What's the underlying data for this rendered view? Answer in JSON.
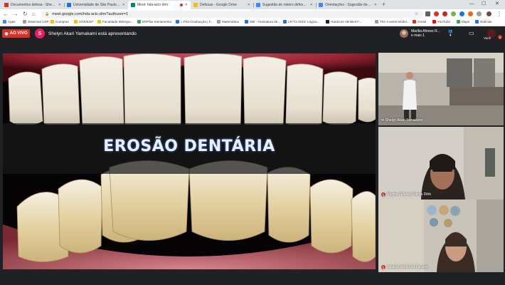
{
  "browser": {
    "tabs": [
      {
        "label": "Documentos defesa - Shelyn Ak",
        "color": "#d93025",
        "active": false
      },
      {
        "label": "Universidade de São Paulo agen",
        "color": "#1a73e8",
        "active": false
      },
      {
        "label": "Meet: hda-actc-dmr",
        "color": "#00897b",
        "active": true
      },
      {
        "label": "Defesas - Google Drive",
        "color": "#fbbc04",
        "active": false
      },
      {
        "label": "Sugestão de roteiro defesa.doc",
        "color": "#4285f4",
        "active": false
      },
      {
        "label": "Orientações - Sugestão de roteir",
        "color": "#4285f4",
        "active": false
      }
    ],
    "new_tab": "+",
    "url": "meet.google.com/hda-actc-dmr?authuser=1",
    "bookmarks": [
      {
        "label": "Apps",
        "color": "#4285f4"
      },
      {
        "label": "Sistemas USP",
        "color": "#9e9e9e"
      },
      {
        "label": "Compras",
        "color": "#fbbc04"
      },
      {
        "label": "UNIVESP",
        "color": "#fbbc04"
      },
      {
        "label": "Faculdade Metropo...",
        "color": "#fbbc04"
      },
      {
        "label": "ERPfax treinamento",
        "color": "#34a853"
      },
      {
        "label": "» Pós-Graduação | F...",
        "color": "#1a73e8"
      },
      {
        "label": "Matemática",
        "color": "#9e9e9e"
      },
      {
        "label": "SBI - Assinatura de...",
        "color": "#1a73e8"
      },
      {
        "label": "LR-T2-2018: Lógica...",
        "color": "#1a73e8"
      },
      {
        "label": "Hardcore 4B Bleit F...",
        "color": "#202124"
      },
      {
        "label": "The 4-week Model...",
        "color": "#9e9e9e"
      },
      {
        "label": "Gmail",
        "color": "#d93025"
      },
      {
        "label": "YouTube",
        "color": "#ff0000"
      },
      {
        "label": "Maps",
        "color": "#34a853"
      },
      {
        "label": "Notícias",
        "color": "#1a73e8"
      }
    ]
  },
  "meet": {
    "live_label": "AO VIVO",
    "presenter_initial": "S",
    "presenting_text": "Shelyn Akari Yamakami está apresentando",
    "top_user_name_line1": "Marília Afonso R...",
    "top_user_name_line2": "e mais 1",
    "people_count": "4",
    "self_badge": "5",
    "you_label": "Você"
  },
  "slide": {
    "title": "EROSÃO DENTÁRIA"
  },
  "participants": [
    {
      "name": "Shelyn Akari Yamakami",
      "muted": false
    },
    {
      "name": "Regina Guenka Palma Dibb",
      "muted": true
    },
    {
      "name": "Juliana Jendiroba Faraoni",
      "muted": true
    }
  ],
  "colors": {
    "live_red": "#d93025",
    "presenter_avatar": "#e91e63",
    "meet_bg": "#202124"
  }
}
